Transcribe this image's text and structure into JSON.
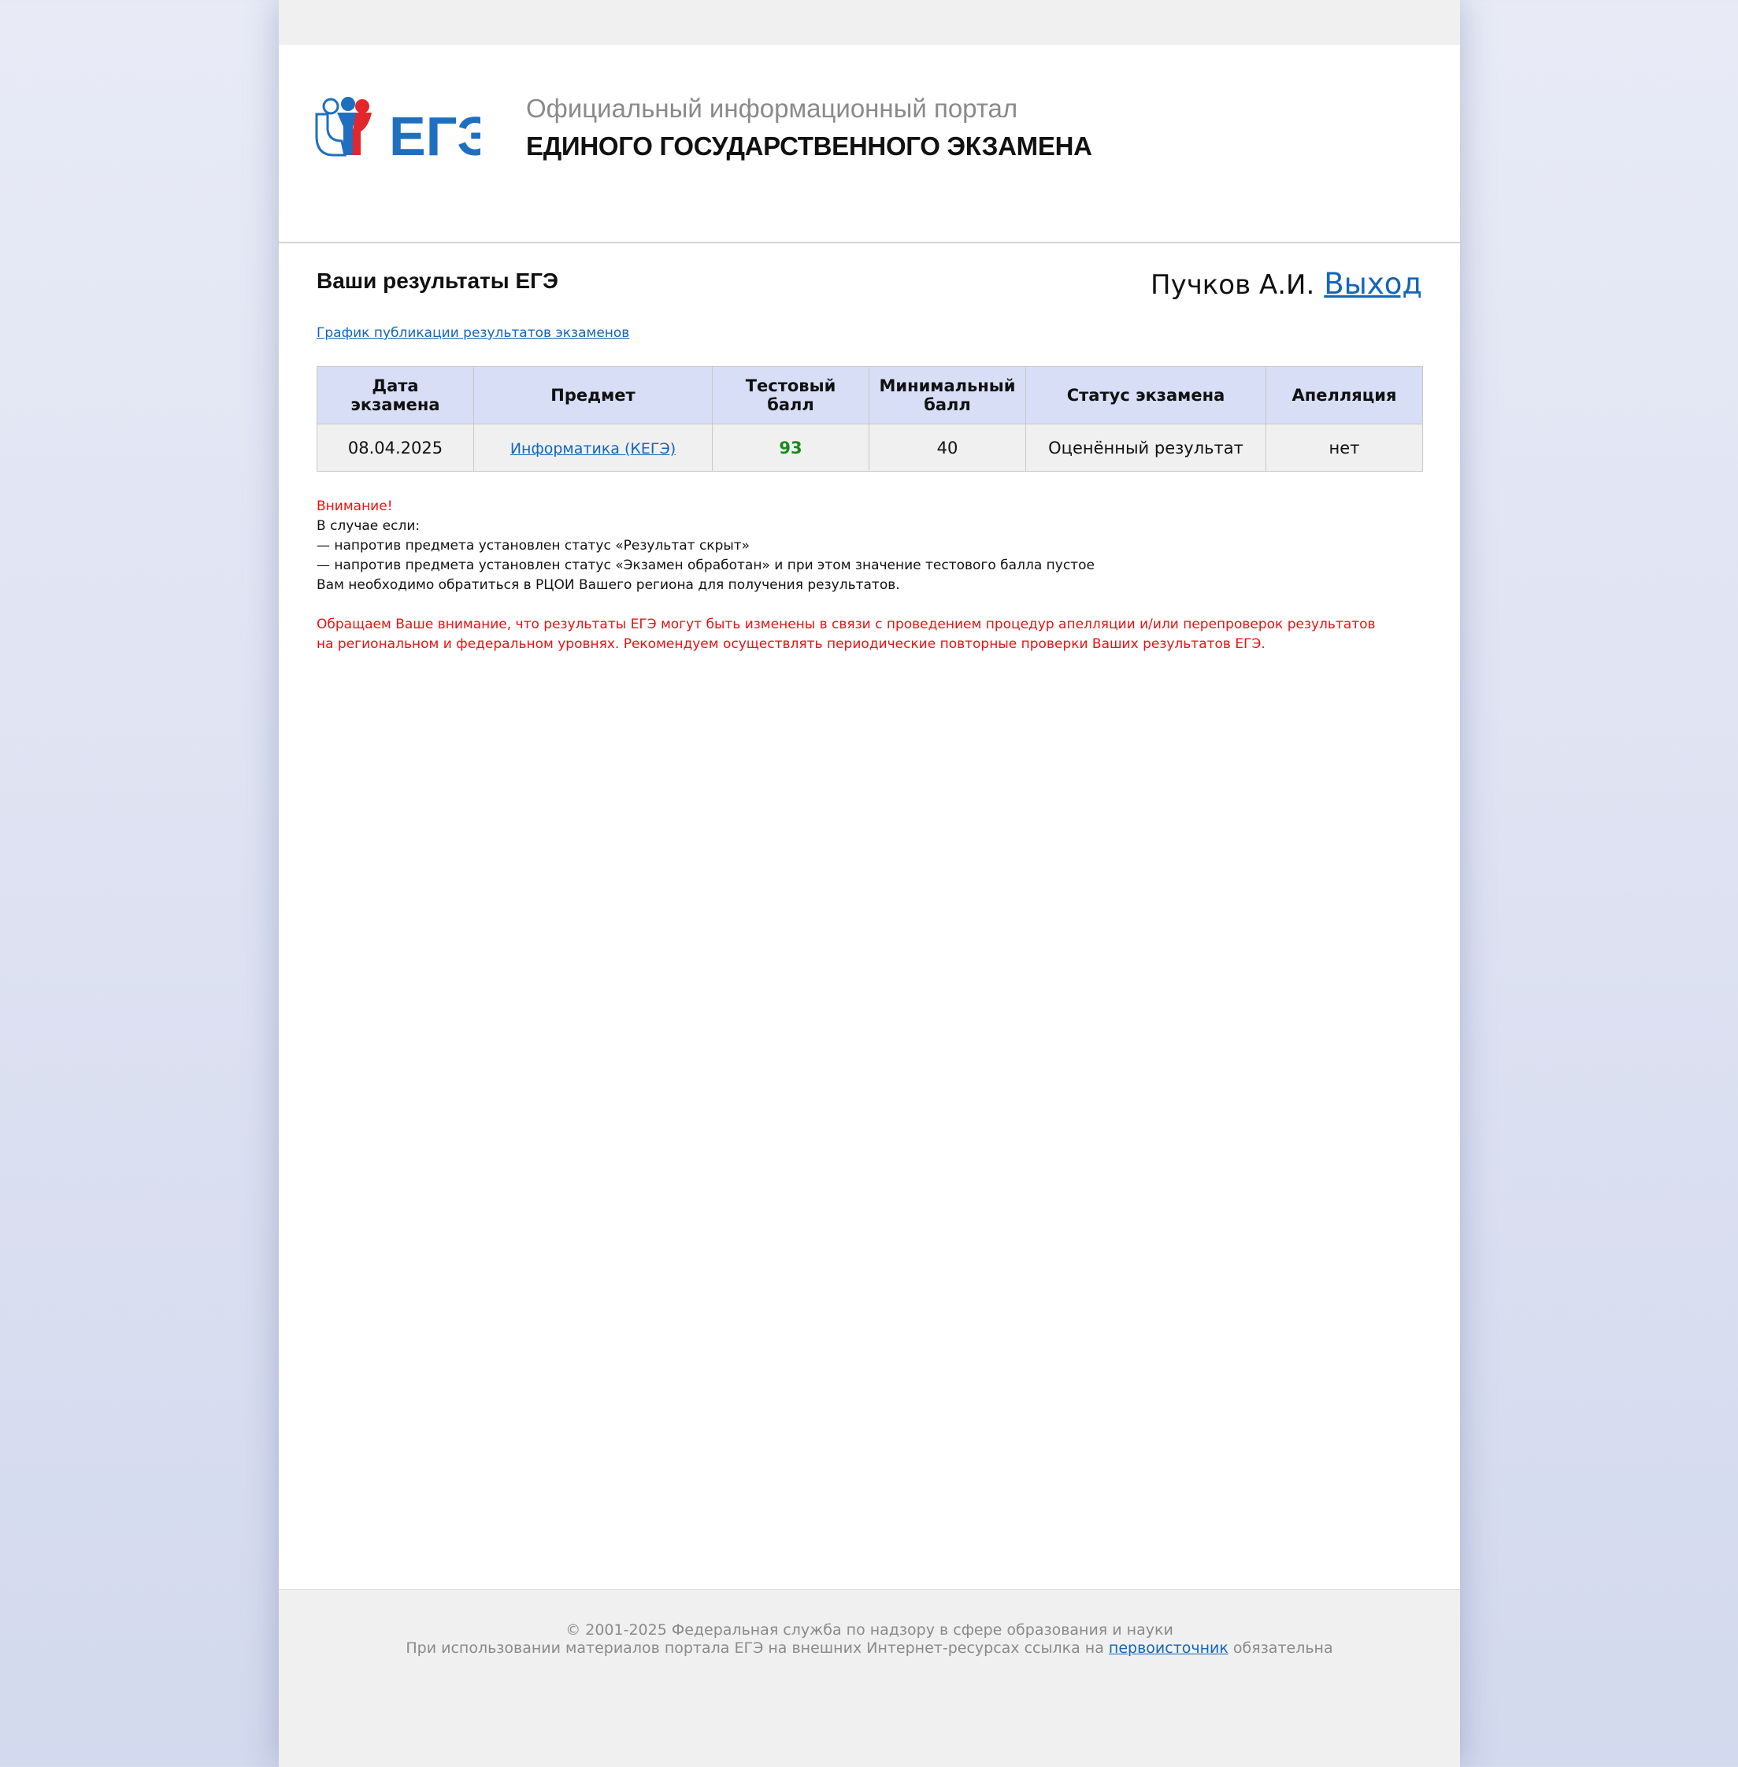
{
  "header": {
    "logo_text": "ЕГЭ",
    "portal_subtitle": "Официальный информационный портал",
    "portal_title": "ЕДИНОГО ГОСУДАРСТВЕННОГО ЭКЗАМЕНА"
  },
  "main": {
    "title": "Ваши результаты ЕГЭ",
    "user_name": "Пучков А.И.",
    "logout_label": "Выход",
    "schedule_link": "График публикации результатов экзаменов",
    "table": {
      "columns": {
        "date_line1": "Дата",
        "date_line2": "экзамена",
        "subject": "Предмет",
        "score_line1": "Тестовый",
        "score_line2": "балл",
        "min_line1": "Минимальный",
        "min_line2": "балл",
        "status": "Статус экзамена",
        "appeal": "Апелляция"
      },
      "rows": [
        {
          "date": "08.04.2025",
          "subject": "Информатика (КЕГЭ)",
          "score": "93",
          "min_score": "40",
          "status": "Оценённый результат",
          "appeal": "нет"
        }
      ]
    },
    "notice": {
      "attention": "Внимание!",
      "line1": "В случае если:",
      "line2": "— напротив предмета установлен статус «Результат скрыт»",
      "line3": "— напротив предмета установлен статус «Экзамен обработан» и при этом значение тестового балла пустое",
      "line4": "Вам необходимо обратиться в РЦОИ Вашего региона для получения результатов.",
      "warning1": "Обращаем Ваше внимание, что результаты ЕГЭ могут быть изменены в связи с проведением процедур апелляции и/или перепроверок результатов",
      "warning2": "на региональном и федеральном уровнях. Рекомендуем осуществлять периодические повторные проверки Ваших результатов ЕГЭ."
    }
  },
  "footer": {
    "copyright": "© 2001-2025 Федеральная служба по надзору в сфере образования и науки",
    "usage_prefix": "При использовании материалов портала ЕГЭ на внешних Интернет-ресурсах ссылка на",
    "usage_link": "первоисточник",
    "usage_suffix": "обязательна"
  },
  "colors": {
    "accent_blue": "#1565b8",
    "logo_blue": "#1f6fc0",
    "logo_red": "#e3262b",
    "warning_red": "#ee1111",
    "score_green": "#1a8a1a",
    "table_header_bg": "#d7def6"
  }
}
